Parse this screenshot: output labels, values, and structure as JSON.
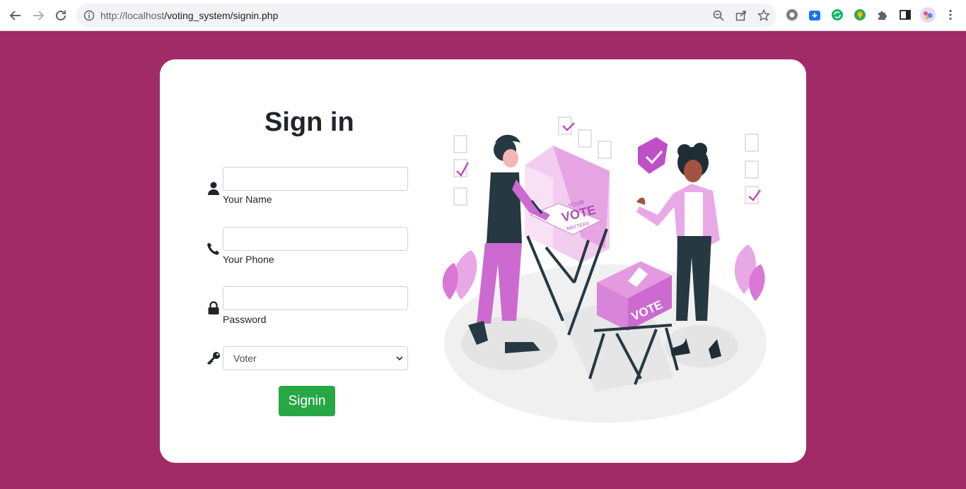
{
  "browser": {
    "url_host": "http://localhost",
    "url_path": "/voting_system/signin.php"
  },
  "form": {
    "title": "Sign in",
    "name_label": "Your Name",
    "phone_label": "Your Phone",
    "password_label": "Password",
    "role_selected": "Voter",
    "submit_label": "Signin"
  },
  "illustration": {
    "booth_text_your": "YOUR",
    "booth_text_vote": "VOTE",
    "booth_text_matters": "MATTERS",
    "box_text": "VOTE"
  },
  "colors": {
    "page_background": "#a12b66",
    "accent_pink": "#cc6ad0",
    "button_green": "#28a745"
  }
}
